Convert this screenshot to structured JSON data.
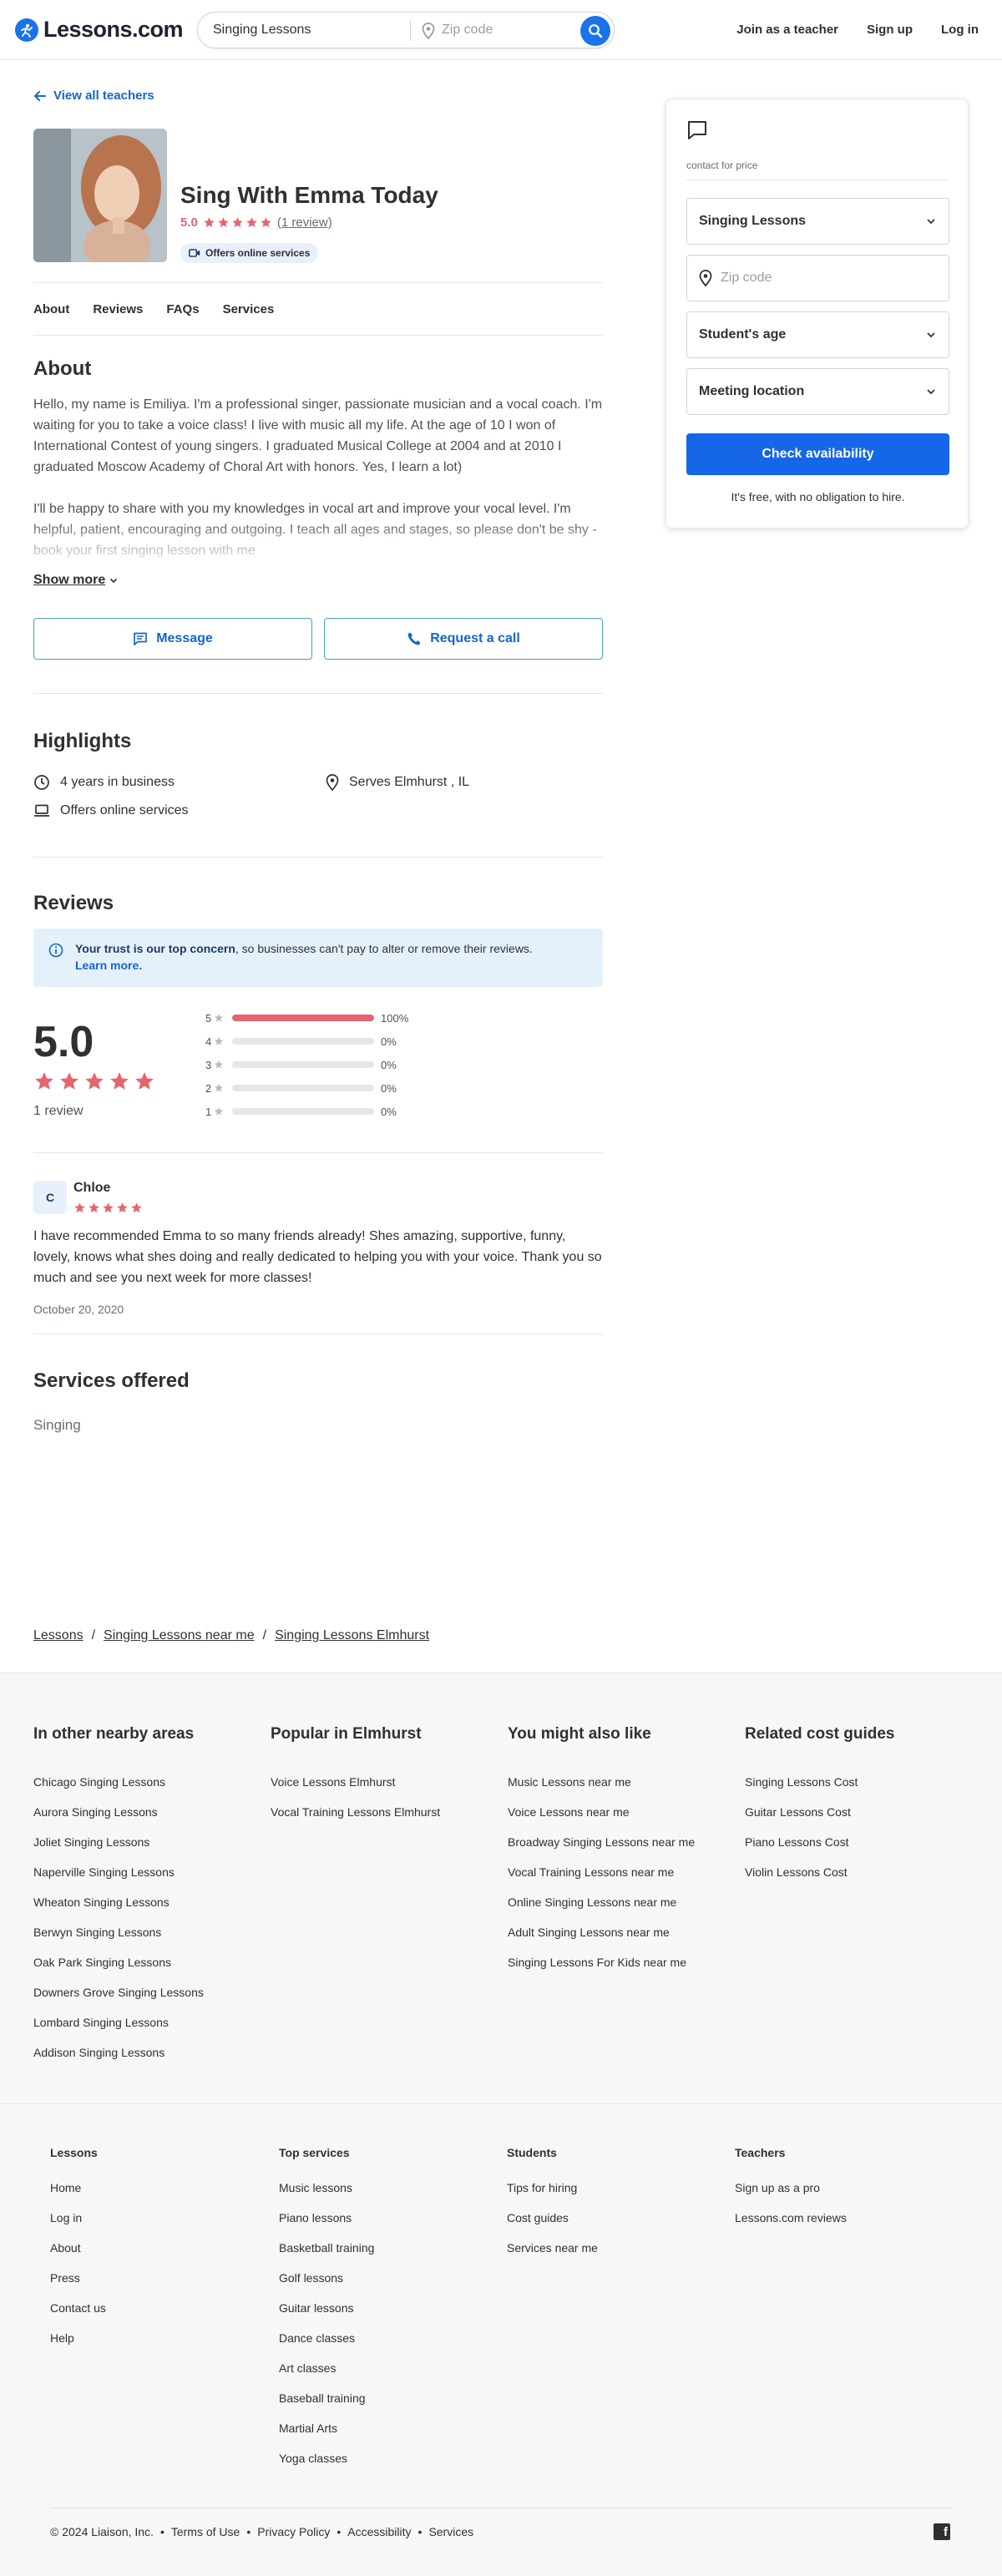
{
  "header": {
    "logo_text": "Lessons.com",
    "search_query": "Singing Lessons",
    "zip_placeholder": "Zip code",
    "nav": [
      "Join as a teacher",
      "Sign up",
      "Log in"
    ]
  },
  "back_link": "View all teachers",
  "profile": {
    "name": "Sing With Emma Today",
    "rating": "5.0",
    "review_link": "(1 review)",
    "badge": "Offers online services"
  },
  "tabs": [
    "About",
    "Reviews",
    "FAQs",
    "Services"
  ],
  "about": {
    "heading": "About",
    "p1": "Hello, my name is Emiliya. I'm a professional singer, passionate musician and a vocal coach. I'm waiting for you to take a voice class! I live with music all my life. At the age of 10 I won of International Contest of young singers. I graduated Musical College at 2004 and at 2010 I graduated Moscow Academy of Choral Art with honors. Yes, I learn a lot)",
    "p2": "I'll be happy to share with you my knowledges in vocal art and improve your vocal level. I'm helpful, patient, encouraging and outgoing. I teach all ages and stages, so please don't be shy - book your first singing lesson with me",
    "show_more": "Show more"
  },
  "actions": {
    "message": "Message",
    "request_call": "Request a call"
  },
  "highlights": {
    "heading": "Highlights",
    "years": "4 years in business",
    "serves": "Serves Elmhurst , IL",
    "online": "Offers online services"
  },
  "reviews": {
    "heading": "Reviews",
    "trust_bold": "Your trust is our top concern",
    "trust_text": ", so businesses can't pay to alter or remove their reviews.",
    "learn_more": "Learn more.",
    "overall": "5.0",
    "count": "1 review",
    "distribution": [
      {
        "stars": "5",
        "pct": "100%",
        "value": 1.0
      },
      {
        "stars": "4",
        "pct": "0%",
        "value": 0
      },
      {
        "stars": "3",
        "pct": "0%",
        "value": 0
      },
      {
        "stars": "2",
        "pct": "0%",
        "value": 0
      },
      {
        "stars": "1",
        "pct": "0%",
        "value": 0
      }
    ],
    "items": [
      {
        "initial": "C",
        "name": "Chloe",
        "text": "I have recommended Emma to so many friends already! Shes amazing, supportive, funny, lovely, knows what shes doing and really dedicated to helping you with your voice. Thank you so much and see you next week for more classes!",
        "date": "October 20, 2020"
      }
    ]
  },
  "services": {
    "heading": "Services offered",
    "items": [
      "Singing"
    ]
  },
  "breadcrumb": [
    "Lessons",
    "Singing Lessons near me",
    "Singing Lessons Elmhurst"
  ],
  "sidebar_card": {
    "price": "contact for price",
    "lesson_select": "Singing Lessons",
    "zip_placeholder": "Zip code",
    "age_select": "Student's age",
    "location_select": "Meeting location",
    "cta": "Check availability",
    "note": "It's free, with no obligation to hire."
  },
  "footer_links": {
    "nearby": {
      "heading": "In other nearby areas",
      "items": [
        "Chicago Singing Lessons",
        "Aurora Singing Lessons",
        "Joliet Singing Lessons",
        "Naperville Singing Lessons",
        "Wheaton Singing Lessons",
        "Berwyn Singing Lessons",
        "Oak Park Singing Lessons",
        "Downers Grove Singing Lessons",
        "Lombard Singing Lessons",
        "Addison Singing Lessons"
      ]
    },
    "popular": {
      "heading": "Popular in Elmhurst",
      "items": [
        "Voice Lessons Elmhurst",
        "Vocal Training Lessons Elmhurst"
      ]
    },
    "also_like": {
      "heading": "You might also like",
      "items": [
        "Music Lessons near me",
        "Voice Lessons near me",
        "Broadway Singing Lessons near me",
        "Vocal Training Lessons near me",
        "Online Singing Lessons near me",
        "Adult Singing Lessons near me",
        "Singing Lessons For Kids near me"
      ]
    },
    "cost_guides": {
      "heading": "Related cost guides",
      "items": [
        "Singing Lessons Cost",
        "Guitar Lessons Cost",
        "Piano Lessons Cost",
        "Violin Lessons Cost"
      ]
    }
  },
  "site_footer": {
    "lessons": {
      "heading": "Lessons",
      "items": [
        "Home",
        "Log in",
        "About",
        "Press",
        "Contact us",
        "Help"
      ]
    },
    "top_services": {
      "heading": "Top services",
      "items": [
        "Music lessons",
        "Piano lessons",
        "Basketball training",
        "Golf lessons",
        "Guitar lessons",
        "Dance classes",
        "Art classes",
        "Baseball training",
        "Martial Arts",
        "Yoga classes"
      ]
    },
    "students": {
      "heading": "Students",
      "items": [
        "Tips for hiring",
        "Cost guides",
        "Services near me"
      ]
    },
    "teachers": {
      "heading": "Teachers",
      "items": [
        "Sign up as a pro",
        "Lessons.com reviews"
      ]
    },
    "legal": [
      "© 2024 Liaison, Inc.",
      "Terms of Use",
      "Privacy Policy",
      "Accessibility",
      "Services"
    ]
  },
  "colors": {
    "brand_blue": "#1a73e8",
    "star_pink": "#e5656f",
    "link_blue": "#1566c8"
  }
}
